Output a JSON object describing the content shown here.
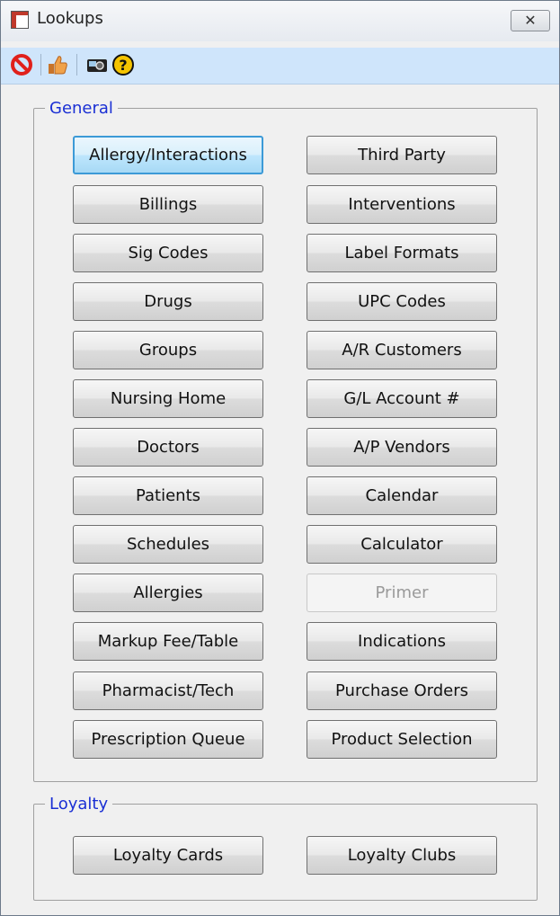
{
  "window": {
    "title": "Lookups",
    "close_label": "✕"
  },
  "toolbar": {
    "icons": [
      "cancel-icon",
      "thumbs-up-icon",
      "camera-icon",
      "help-icon"
    ]
  },
  "general": {
    "legend": "General",
    "left_buttons": [
      "Allergy/Interactions",
      "Billings",
      "Sig Codes",
      "Drugs",
      "Groups",
      "Nursing Home",
      "Doctors",
      "Patients",
      "Schedules",
      "Allergies",
      "Markup Fee/Table",
      "Pharmacist/Tech",
      "Prescription Queue"
    ],
    "right_buttons": [
      "Third Party",
      "Interventions",
      "Label Formats",
      "UPC Codes",
      "A/R Customers",
      "G/L Account #",
      "A/P Vendors",
      "Calendar",
      "Calculator",
      "Primer",
      "Indications",
      "Purchase Orders",
      "Product Selection"
    ],
    "focused_button": "Allergy/Interactions",
    "disabled_button": "Primer"
  },
  "loyalty": {
    "legend": "Loyalty",
    "buttons": [
      "Loyalty Cards",
      "Loyalty Clubs"
    ]
  },
  "colors": {
    "legend_text": "#1a2fd4",
    "toolbar_bg": "#cfe5fb",
    "focus_border": "#3c9ad7"
  }
}
